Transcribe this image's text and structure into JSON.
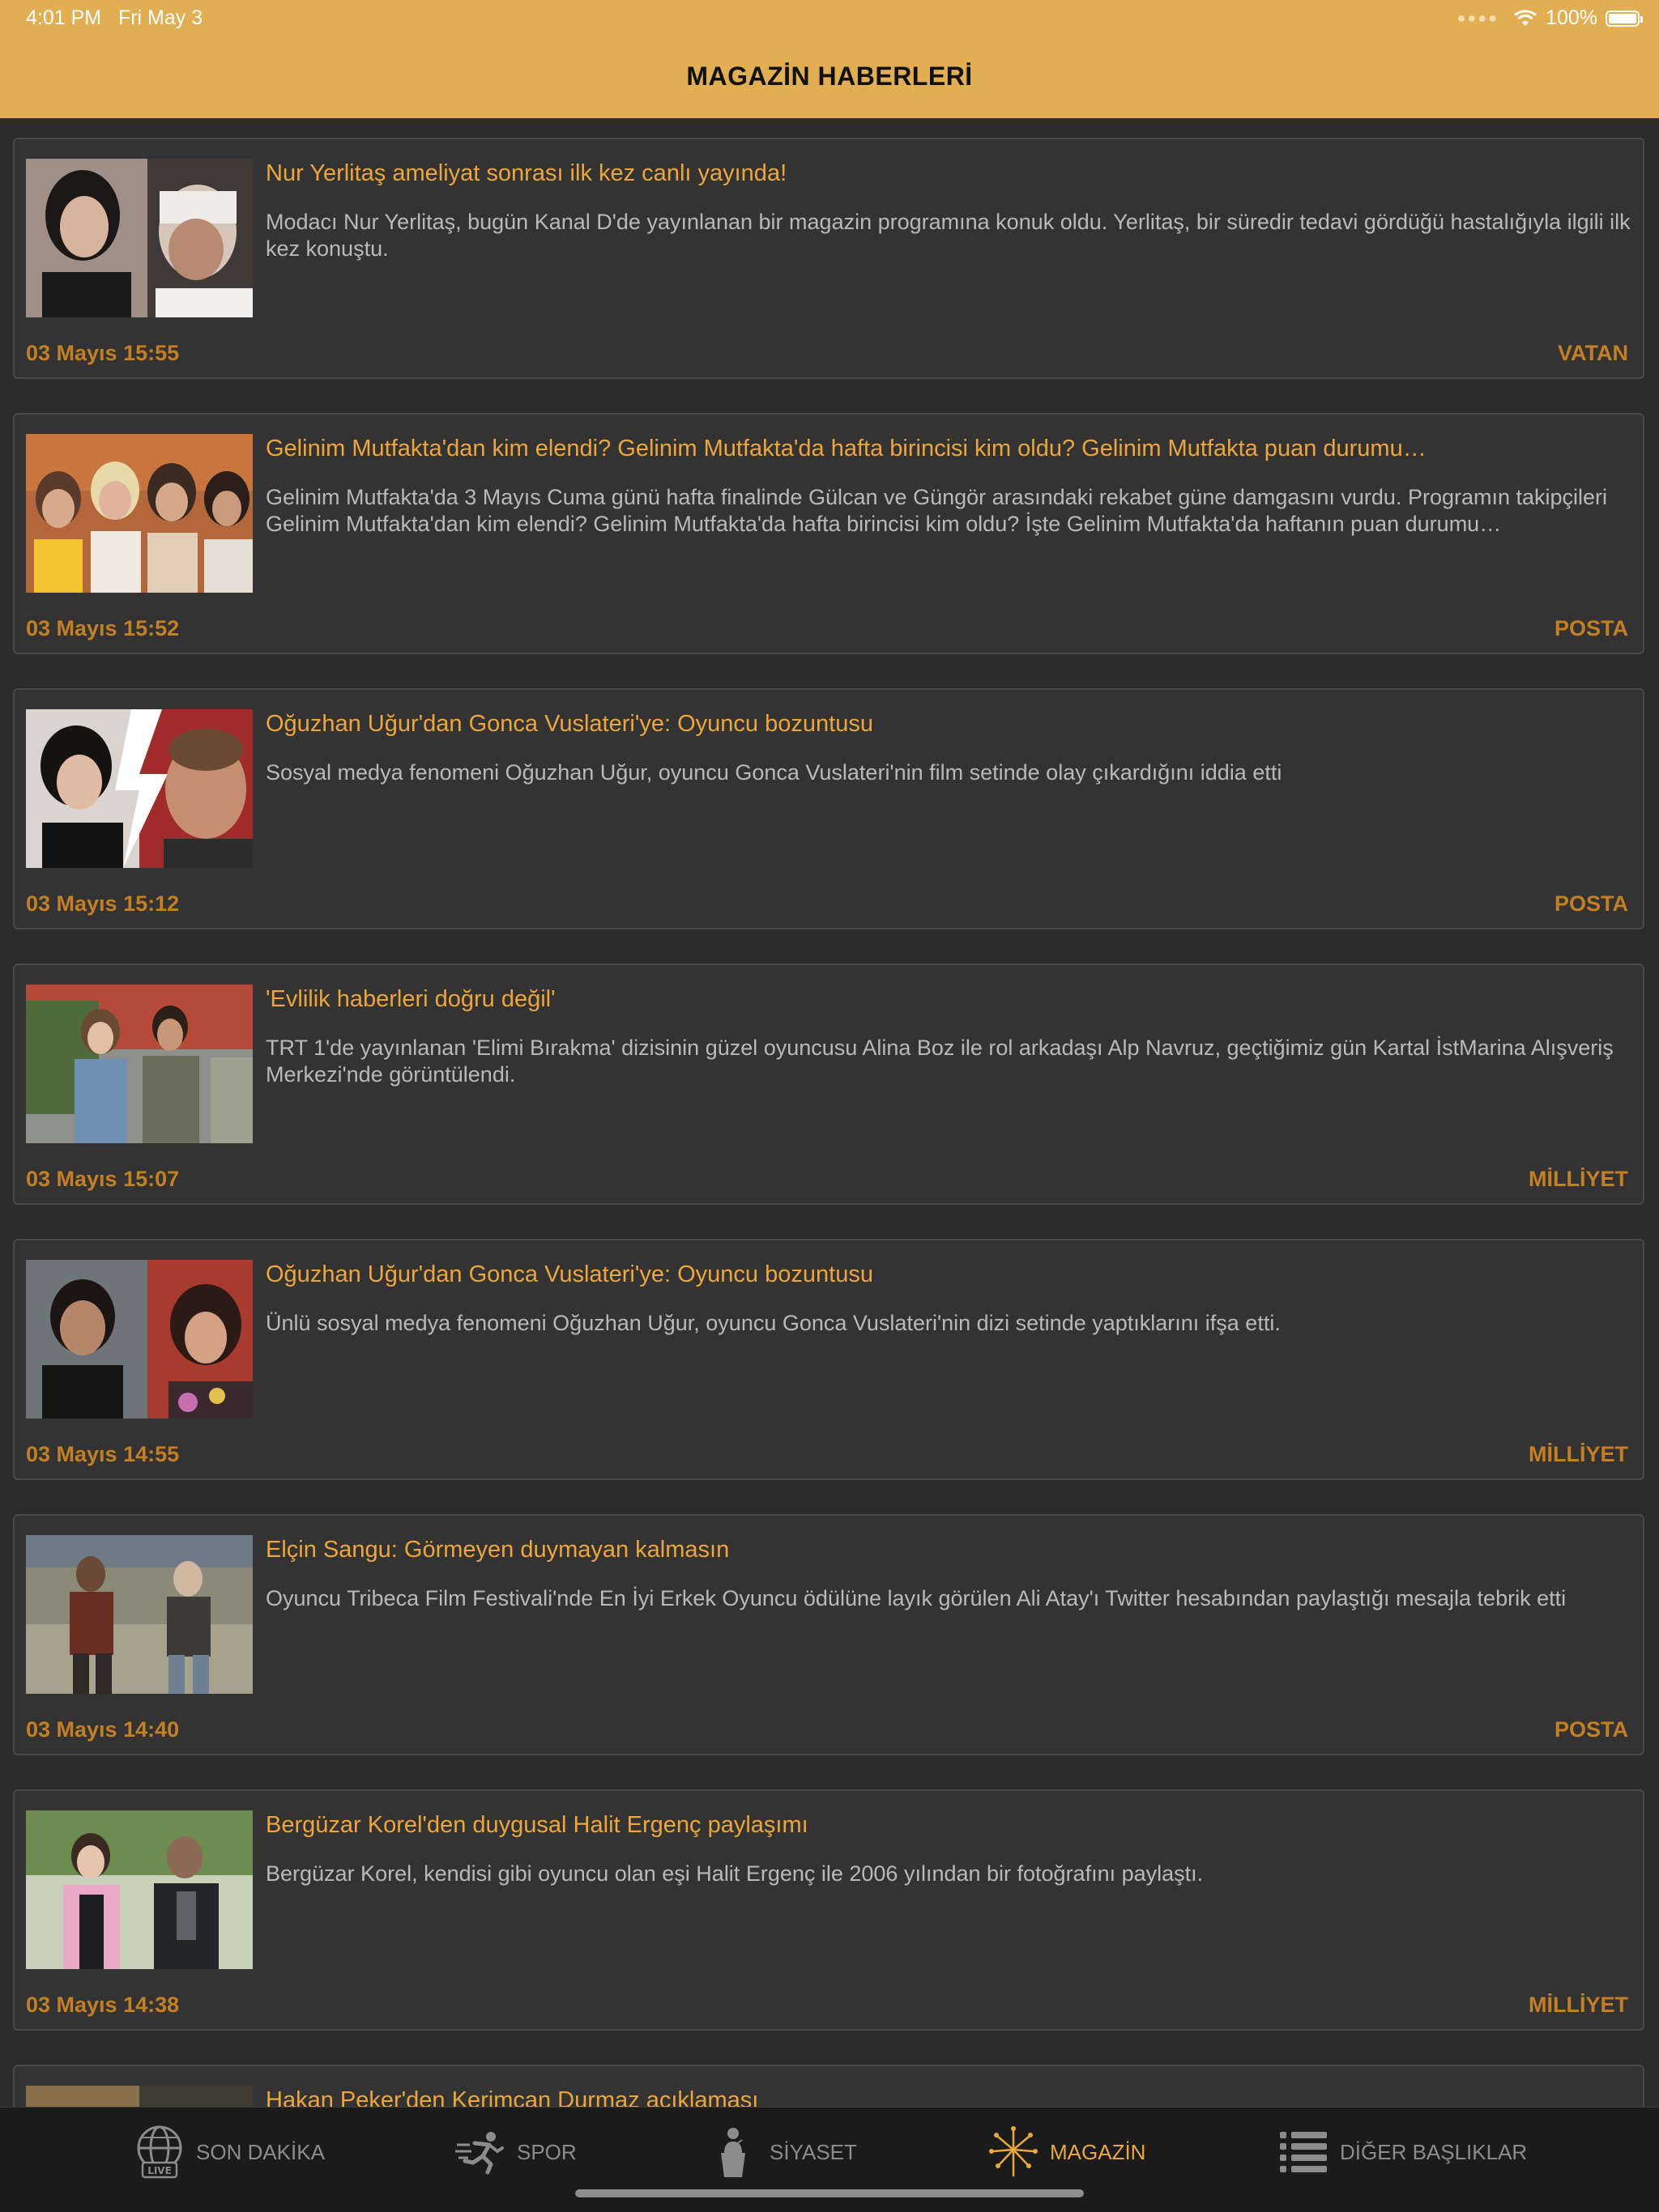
{
  "status_bar": {
    "time": "4:01 PM   Fri May 3",
    "battery": "100%"
  },
  "nav": {
    "title": "MAGAZİN HABERLERİ"
  },
  "articles": [
    {
      "title": "Nur Yerlitaş ameliyat sonrası ilk kez canlı yayında!",
      "description": "Modacı Nur Yerlitaş, bugün Kanal D'de yayınlanan bir magazin programına konuk oldu. Yerlitaş, bir süredir tedavi gördüğü hastalığıyla ilgili ilk kez konuştu.",
      "date": "03 Mayıs 15:55",
      "source": "VATAN"
    },
    {
      "title": "Gelinim Mutfakta'dan kim elendi? Gelinim Mutfakta'da hafta birincisi kim oldu? Gelinim Mutfakta puan durumu…",
      "description": "Gelinim Mutfakta'da 3 Mayıs Cuma günü hafta finalinde Gülcan ve Güngör arasındaki rekabet güne damgasını vurdu. Programın takipçileri Gelinim Mutfakta'dan kim elendi? Gelinim Mutfakta'da hafta birincisi kim oldu? İşte Gelinim Mutfakta'da haftanın puan durumu…",
      "date": "03 Mayıs 15:52",
      "source": "POSTA"
    },
    {
      "title": "Oğuzhan Uğur'dan Gonca Vuslateri'ye: Oyuncu bozuntusu",
      "description": "Sosyal medya fenomeni Oğuzhan Uğur, oyuncu Gonca Vuslateri'nin film setinde olay çıkardığını iddia etti",
      "date": "03 Mayıs 15:12",
      "source": "POSTA"
    },
    {
      "title": "'Evlilik haberleri doğru değil'",
      "description": "TRT 1'de yayınlanan 'Elimi Bırakma' dizisinin güzel oyuncusu Alina Boz ile rol arkadaşı Alp Navruz, geçtiğimiz gün Kartal İstMarina Alışveriş Merkezi'nde görüntülendi.",
      "date": "03 Mayıs 15:07",
      "source": "MİLLİYET"
    },
    {
      "title": "Oğuzhan Uğur'dan Gonca Vuslateri'ye: Oyuncu bozuntusu",
      "description": "Ünlü sosyal medya fenomeni Oğuzhan Uğur, oyuncu Gonca Vuslateri'nin dizi setinde yaptıklarını ifşa etti.",
      "date": "03 Mayıs 14:55",
      "source": "MİLLİYET"
    },
    {
      "title": "Elçin Sangu: Görmeyen duymayan kalmasın",
      "description": "Oyuncu Tribeca Film Festivali'nde En İyi Erkek Oyuncu ödülüne layık görülen Ali Atay'ı Twitter hesabından paylaştığı mesajla tebrik etti",
      "date": "03 Mayıs 14:40",
      "source": "POSTA"
    },
    {
      "title": "Bergüzar Korel'den duygusal Halit Ergenç paylaşımı",
      "description": "Bergüzar Korel, kendisi gibi oyuncu olan eşi Halit Ergenç ile 2006 yılından bir fotoğrafını paylaştı.",
      "date": "03 Mayıs 14:38",
      "source": "MİLLİYET"
    },
    {
      "title": "Hakan Peker'den Kerimcan Durmaz açıklaması",
      "description": "",
      "date": "",
      "source": ""
    }
  ],
  "tabs": [
    {
      "label": "SON DAKİKA",
      "icon": "globe-live-icon"
    },
    {
      "label": "SPOR",
      "icon": "runner-icon"
    },
    {
      "label": "SİYASET",
      "icon": "podium-speaker-icon"
    },
    {
      "label": "MAGAZİN",
      "icon": "fireworks-icon",
      "active": true
    },
    {
      "label": "DİĞER BAŞLIKLAR",
      "icon": "list-icon"
    }
  ],
  "colors": {
    "accent": "#e2ae52",
    "title_orange": "#eda63a",
    "meta_orange": "#c47f22",
    "background": "#2b2b2b",
    "card": "#333333",
    "tabbar": "#1b1b1b"
  }
}
